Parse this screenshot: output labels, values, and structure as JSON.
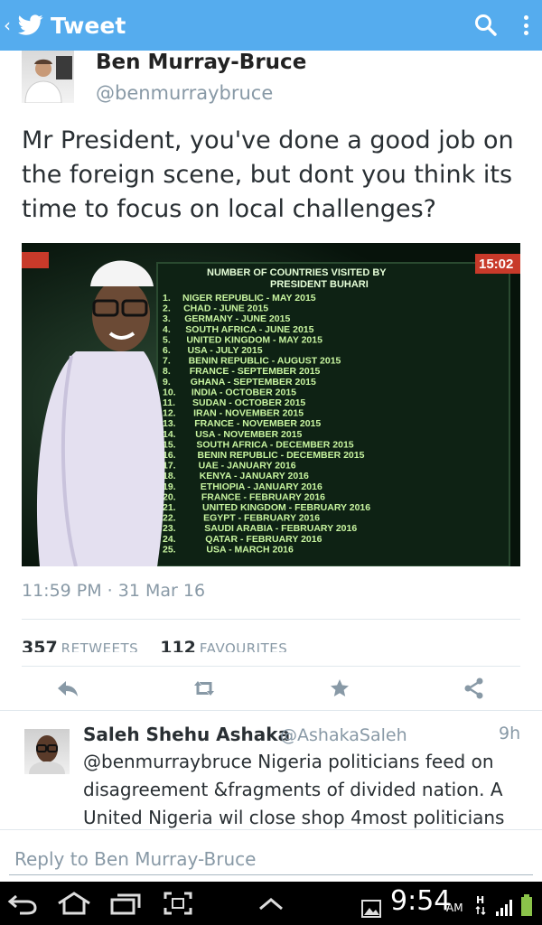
{
  "app_bar": {
    "title": "Tweet"
  },
  "tweet": {
    "author_name": "Ben Murray-Bruce",
    "author_handle": "@benmurraybruce",
    "text": "Mr President, you've done a good job on the foreign scene, but dont you think its time to focus on local challenges?",
    "timestamp": "11:59 PM · 31 Mar 16",
    "retweets_count": "357",
    "retweets_label": "RETWEETS",
    "favourites_count": "112",
    "favourites_label": "FAVOURITES"
  },
  "photo": {
    "tv_time": "15:02",
    "heading_line1": "NUMBER OF COUNTRIES VISITED BY",
    "heading_line2": "PRESIDENT BUHARI",
    "visits": [
      "NIGER REPUBLIC - MAY 2015",
      "CHAD - JUNE 2015",
      "GERMANY - JUNE 2015",
      "SOUTH AFRICA - JUNE 2015",
      "UNITED KINGDOM - MAY 2015",
      "USA - JULY 2015",
      "BENIN REPUBLIC - AUGUST 2015",
      "FRANCE - SEPTEMBER 2015",
      "GHANA - SEPTEMBER 2015",
      "INDIA - OCTOBER 2015",
      "SUDAN - OCTOBER 2015",
      "IRAN - NOVEMBER 2015",
      "FRANCE - NOVEMBER 2015",
      "USA - NOVEMBER 2015",
      "SOUTH AFRICA - DECEMBER 2015",
      "BENIN REPUBLIC - DECEMBER 2015",
      "UAE - JANUARY 2016",
      "KENYA - JANUARY 2016",
      "ETHIOPIA - JANUARY 2016",
      "FRANCE - FEBRUARY 2016",
      "UNITED KINGDOM - FEBRUARY 2016",
      "EGYPT - FEBRUARY 2016",
      "SAUDI ARABIA - FEBRUARY 2016",
      "QATAR - FEBRUARY 2016",
      "USA - MARCH 2016"
    ]
  },
  "reply": {
    "author_name": "Saleh Shehu Ashaka",
    "author_handle": "@AshakaSaleh",
    "time": "9h",
    "text": "@benmurraybruce Nigeria politicians feed on disagreement &fragments of divided nation. A United Nigeria wil close shop 4most politicians"
  },
  "reply_box": {
    "placeholder": "Reply to Ben Murray-Bruce"
  },
  "status_bar": {
    "time": "9:54",
    "ampm": "AM"
  },
  "colors": {
    "accent": "#55acee",
    "muted": "#8899a6",
    "text": "#292f33",
    "tv_green": "#c8f5a0"
  },
  "icons": [
    "back-chevron-icon",
    "twitter-bird-icon",
    "search-icon",
    "overflow-menu-icon",
    "reply-icon",
    "retweet-icon",
    "favourite-star-icon",
    "share-icon",
    "nav-back-icon",
    "nav-home-icon",
    "nav-recents-icon",
    "screenshot-icon",
    "nav-up-icon",
    "gallery-icon",
    "hspa-signal-icon",
    "signal-bars-icon",
    "battery-icon"
  ]
}
